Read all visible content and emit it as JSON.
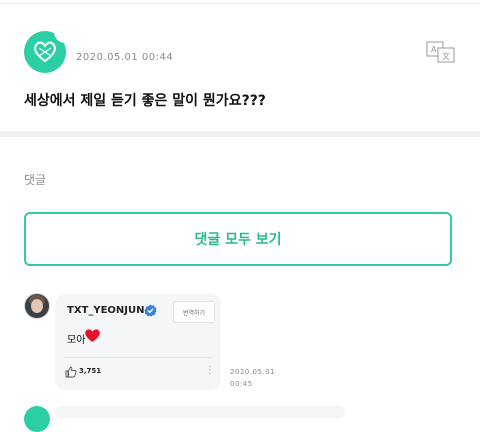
{
  "post": {
    "date": "2020.05.01 00:44",
    "text": "세상에서 제일 듣기 좋은 말이 뭔가요???",
    "translate_icon": "translate-icon",
    "avatar_color": "#2ccfa5"
  },
  "comments_section": {
    "label": "댓글",
    "view_all_label": "댓글 모두 보기",
    "accent_color": "#35c9a5"
  },
  "comment": {
    "author": "TXT_YEONJUN",
    "verified": true,
    "translate_button": "번역하기",
    "text": "모아",
    "emoji": "heart",
    "likes": "3,751",
    "date": "2020.05.01",
    "time": "00:45"
  }
}
